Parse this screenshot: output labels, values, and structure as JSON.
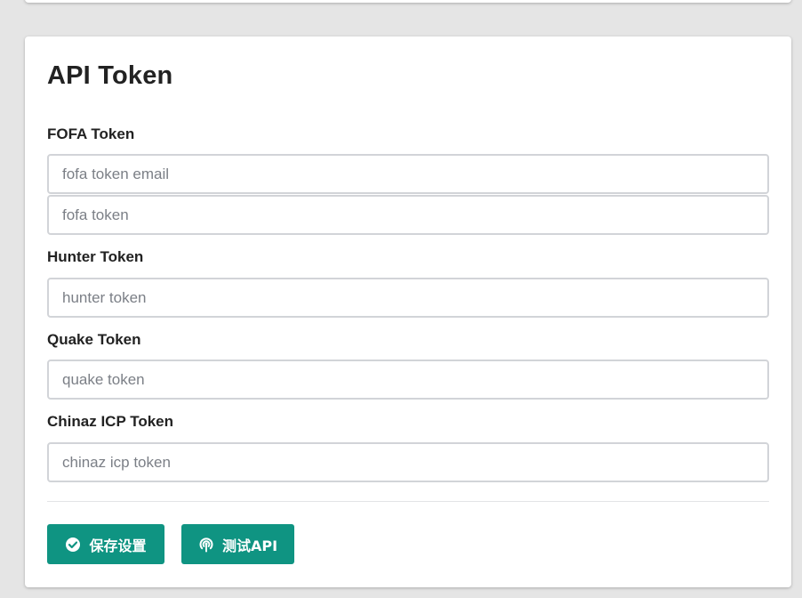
{
  "card": {
    "title": "API Token"
  },
  "fofa": {
    "label": "FOFA Token",
    "email_placeholder": "fofa token email",
    "token_placeholder": "fofa token"
  },
  "hunter": {
    "label": "Hunter Token",
    "placeholder": "hunter token"
  },
  "quake": {
    "label": "Quake Token",
    "placeholder": "quake token"
  },
  "chinaz": {
    "label": "Chinaz ICP Token",
    "placeholder": "chinaz icp token"
  },
  "actions": {
    "save_label": "保存设置",
    "save_icon": "check-circle-icon",
    "test_label": "测试API",
    "test_icon": "broadcast-icon"
  },
  "colors": {
    "accent": "#0f9482",
    "background": "#e5e5e5"
  }
}
